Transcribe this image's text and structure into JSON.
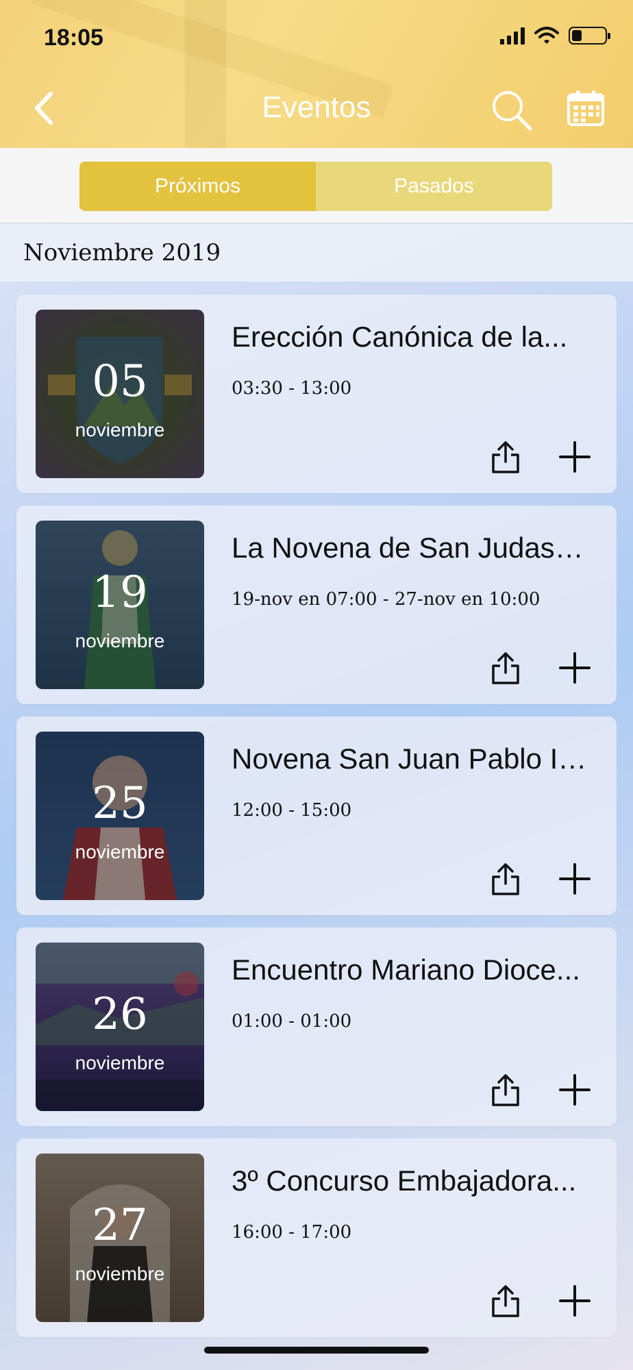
{
  "status_bar": {
    "time": "18:05",
    "battery_level": 0.3
  },
  "header": {
    "title": "Eventos"
  },
  "tabs": [
    {
      "label": "Próximos",
      "active": true
    },
    {
      "label": "Pasados",
      "active": false
    }
  ],
  "section": {
    "month": "Noviembre 2019"
  },
  "events": [
    {
      "day": "05",
      "month": "noviembre",
      "title": "Erección Canónica de la...",
      "time": "03:30 - 13:00"
    },
    {
      "day": "19",
      "month": "noviembre",
      "title": "La Novena de San Judas T...",
      "time": "19-nov en 07:00 - 27-nov en 10:00"
    },
    {
      "day": "25",
      "month": "noviembre",
      "title": "Novena San Juan Pablo II...",
      "time": "12:00 - 15:00"
    },
    {
      "day": "26",
      "month": "noviembre",
      "title": "Encuentro Mariano Dioce...",
      "time": "01:00 - 01:00"
    },
    {
      "day": "27",
      "month": "noviembre",
      "title": "3º Concurso Embajadora...",
      "time": "16:00 - 17:00"
    }
  ],
  "colors": {
    "header_accent": "#f3d27a",
    "tab_active": "#e3c23e",
    "tab_inactive": "#e9d87a"
  }
}
